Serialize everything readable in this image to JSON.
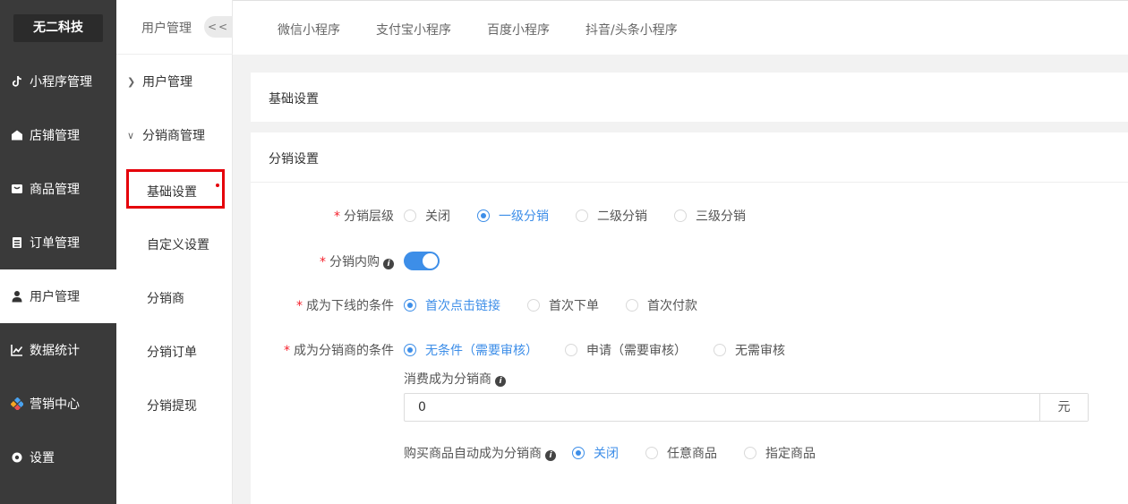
{
  "brand": "无二科技",
  "sidebar": {
    "items": [
      {
        "label": "小程序管理",
        "icon": "tiktok-icon"
      },
      {
        "label": "店铺管理",
        "icon": "store-icon"
      },
      {
        "label": "商品管理",
        "icon": "bag-icon"
      },
      {
        "label": "订单管理",
        "icon": "clipboard-icon"
      },
      {
        "label": "用户管理",
        "icon": "user-icon",
        "active": true
      },
      {
        "label": "数据统计",
        "icon": "chart-icon"
      },
      {
        "label": "营销中心",
        "icon": "marketing-icon"
      },
      {
        "label": "设置",
        "icon": "gear-icon"
      }
    ]
  },
  "submenu": {
    "title": "用户管理",
    "collapse": "<<",
    "groups": [
      {
        "label": "用户管理",
        "expanded": false
      },
      {
        "label": "分销商管理",
        "expanded": true
      }
    ],
    "items": [
      "基础设置",
      "自定义设置",
      "分销商",
      "分销订单",
      "分销提现"
    ]
  },
  "tabs": [
    "微信小程序",
    "支付宝小程序",
    "百度小程序",
    "抖音/头条小程序"
  ],
  "panel_basic": {
    "title": "基础设置"
  },
  "panel_dist": {
    "title": "分销设置",
    "level": {
      "label": "分销层级",
      "options": [
        "关闭",
        "一级分销",
        "二级分销",
        "三级分销"
      ],
      "selected": 1
    },
    "inner_buy": {
      "label": "分销内购",
      "enabled": true
    },
    "downline": {
      "label": "成为下线的条件",
      "options": [
        "首次点击链接",
        "首次下单",
        "首次付款"
      ],
      "selected": 0
    },
    "become": {
      "label": "成为分销商的条件",
      "options": [
        "无条件（需要审核）",
        "申请（需要审核）",
        "无需审核"
      ],
      "selected": 0
    },
    "spend": {
      "label": "消费成为分销商",
      "value": "0",
      "unit": "元"
    },
    "auto_buy": {
      "label": "购买商品自动成为分销商",
      "options": [
        "关闭",
        "任意商品",
        "指定商品"
      ],
      "selected": 0
    }
  },
  "colors": {
    "accent": "#3d8ee8",
    "sidebar": "#3a3a3a",
    "highlight": "#e5000a",
    "required": "#f5222d"
  }
}
